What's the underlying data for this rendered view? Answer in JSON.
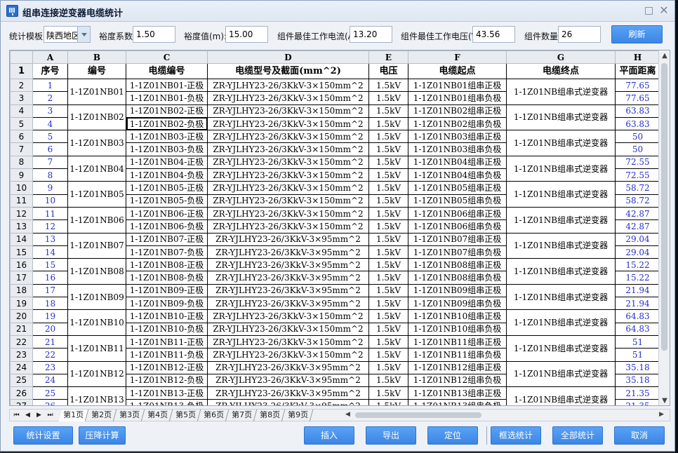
{
  "window": {
    "title": "组串连接逆变器电缆统计"
  },
  "toolbar": {
    "template_label": "统计模板:",
    "template_value": "陕西地区",
    "margin_coef_label": "裕度系数:",
    "margin_coef_value": "1.50",
    "margin_value_label": "裕度值(m):",
    "margin_value_value": "15.00",
    "best_current_label": "组件最佳工作电流(A):",
    "best_current_value": "13.20",
    "best_voltage_label": "组件最佳工作电压(V):",
    "best_voltage_value": "43.56",
    "module_count_label": "组件数量:",
    "module_count_value": "26",
    "refresh_label": "刷新"
  },
  "sheet": {
    "col_letters": [
      "A",
      "B",
      "C",
      "D",
      "E",
      "F",
      "G",
      "H"
    ],
    "header": [
      "序号",
      "编号",
      "电缆编号",
      "电缆型号及截面(mm^2)",
      "电压",
      "电缆起点",
      "电缆终点",
      "平面距离"
    ],
    "groups": [
      {
        "code": "1-1Z01NB01",
        "dest": "1-1Z01NB组串式逆变器",
        "rows": [
          {
            "seq": "1",
            "cable": "1-1Z01NB01-正极",
            "model": "ZR-YJLHY23-26/3KkV-3×150mm^2",
            "volt": "1.5kV",
            "start": "1-1Z01NB01组串正极",
            "dist": "77.65"
          },
          {
            "seq": "2",
            "cable": "1-1Z01NB01-负极",
            "model": "ZR-YJLHY23-26/3KkV-3×150mm^2",
            "volt": "1.5kV",
            "start": "1-1Z01NB01组串负极",
            "dist": "77.65"
          }
        ]
      },
      {
        "code": "1-1Z01NB02",
        "dest": "1-1Z01NB组串式逆变器",
        "rows": [
          {
            "seq": "3",
            "cable": "1-1Z01NB02-正极",
            "model": "ZR-YJLHY23-26/3KkV-3×150mm^2",
            "volt": "1.5kV",
            "start": "1-1Z01NB02组串正极",
            "dist": "63.83"
          },
          {
            "seq": "4",
            "cable": "1-1Z01NB02-负极",
            "model": "ZR-YJLHY23-26/3KkV-3×150mm^2",
            "volt": "1.5kV",
            "start": "1-1Z01NB02组串负极",
            "dist": "63.83"
          }
        ]
      },
      {
        "code": "1-1Z01NB03",
        "dest": "1-1Z01NB组串式逆变器",
        "rows": [
          {
            "seq": "5",
            "cable": "1-1Z01NB03-正极",
            "model": "ZR-YJLHY23-26/3KkV-3×150mm^2",
            "volt": "1.5kV",
            "start": "1-1Z01NB03组串正极",
            "dist": "50"
          },
          {
            "seq": "6",
            "cable": "1-1Z01NB03-负极",
            "model": "ZR-YJLHY23-26/3KkV-3×150mm^2",
            "volt": "1.5kV",
            "start": "1-1Z01NB03组串负极",
            "dist": "50"
          }
        ]
      },
      {
        "code": "1-1Z01NB04",
        "dest": "1-1Z01NB组串式逆变器",
        "rows": [
          {
            "seq": "7",
            "cable": "1-1Z01NB04-正极",
            "model": "ZR-YJLHY23-26/3KkV-3×150mm^2",
            "volt": "1.5kV",
            "start": "1-1Z01NB04组串正极",
            "dist": "72.55"
          },
          {
            "seq": "8",
            "cable": "1-1Z01NB04-负极",
            "model": "ZR-YJLHY23-26/3KkV-3×150mm^2",
            "volt": "1.5kV",
            "start": "1-1Z01NB04组串负极",
            "dist": "72.55"
          }
        ]
      },
      {
        "code": "1-1Z01NB05",
        "dest": "1-1Z01NB组串式逆变器",
        "rows": [
          {
            "seq": "9",
            "cable": "1-1Z01NB05-正极",
            "model": "ZR-YJLHY23-26/3KkV-3×150mm^2",
            "volt": "1.5kV",
            "start": "1-1Z01NB05组串正极",
            "dist": "58.72"
          },
          {
            "seq": "10",
            "cable": "1-1Z01NB05-负极",
            "model": "ZR-YJLHY23-26/3KkV-3×150mm^2",
            "volt": "1.5kV",
            "start": "1-1Z01NB05组串负极",
            "dist": "58.72"
          }
        ]
      },
      {
        "code": "1-1Z01NB06",
        "dest": "1-1Z01NB组串式逆变器",
        "rows": [
          {
            "seq": "11",
            "cable": "1-1Z01NB06-正极",
            "model": "ZR-YJLHY23-26/3KkV-3×150mm^2",
            "volt": "1.5kV",
            "start": "1-1Z01NB06组串正极",
            "dist": "42.87"
          },
          {
            "seq": "12",
            "cable": "1-1Z01NB06-负极",
            "model": "ZR-YJLHY23-26/3KkV-3×150mm^2",
            "volt": "1.5kV",
            "start": "1-1Z01NB06组串负极",
            "dist": "42.87"
          }
        ]
      },
      {
        "code": "1-1Z01NB07",
        "dest": "1-1Z01NB组串式逆变器",
        "rows": [
          {
            "seq": "13",
            "cable": "1-1Z01NB07-正极",
            "model": "ZR-YJLHY23-26/3KkV-3×95mm^2",
            "volt": "1.5kV",
            "start": "1-1Z01NB07组串正极",
            "dist": "29.04"
          },
          {
            "seq": "14",
            "cable": "1-1Z01NB07-负极",
            "model": "ZR-YJLHY23-26/3KkV-3×95mm^2",
            "volt": "1.5kV",
            "start": "1-1Z01NB07组串负极",
            "dist": "29.04"
          }
        ]
      },
      {
        "code": "1-1Z01NB08",
        "dest": "1-1Z01NB组串式逆变器",
        "rows": [
          {
            "seq": "15",
            "cable": "1-1Z01NB08-正极",
            "model": "ZR-YJLHY23-26/3KkV-3×95mm^2",
            "volt": "1.5kV",
            "start": "1-1Z01NB08组串正极",
            "dist": "15.22"
          },
          {
            "seq": "16",
            "cable": "1-1Z01NB08-负极",
            "model": "ZR-YJLHY23-26/3KkV-3×95mm^2",
            "volt": "1.5kV",
            "start": "1-1Z01NB08组串负极",
            "dist": "15.22"
          }
        ]
      },
      {
        "code": "1-1Z01NB09",
        "dest": "1-1Z01NB组串式逆变器",
        "rows": [
          {
            "seq": "17",
            "cable": "1-1Z01NB09-正极",
            "model": "ZR-YJLHY23-26/3KkV-3×95mm^2",
            "volt": "1.5kV",
            "start": "1-1Z01NB09组串正极",
            "dist": "21.94"
          },
          {
            "seq": "18",
            "cable": "1-1Z01NB09-负极",
            "model": "ZR-YJLHY23-26/3KkV-3×95mm^2",
            "volt": "1.5kV",
            "start": "1-1Z01NB09组串负极",
            "dist": "21.94"
          }
        ]
      },
      {
        "code": "1-1Z01NB10",
        "dest": "1-1Z01NB组串式逆变器",
        "rows": [
          {
            "seq": "19",
            "cable": "1-1Z01NB10-正极",
            "model": "ZR-YJLHY23-26/3KkV-3×150mm^2",
            "volt": "1.5kV",
            "start": "1-1Z01NB10组串正极",
            "dist": "64.83"
          },
          {
            "seq": "20",
            "cable": "1-1Z01NB10-负极",
            "model": "ZR-YJLHY23-26/3KkV-3×150mm^2",
            "volt": "1.5kV",
            "start": "1-1Z01NB10组串负极",
            "dist": "64.83"
          }
        ]
      },
      {
        "code": "1-1Z01NB11",
        "dest": "1-1Z01NB组串式逆变器",
        "rows": [
          {
            "seq": "21",
            "cable": "1-1Z01NB11-正极",
            "model": "ZR-YJLHY23-26/3KkV-3×150mm^2",
            "volt": "1.5kV",
            "start": "1-1Z01NB11组串正极",
            "dist": "51"
          },
          {
            "seq": "22",
            "cable": "1-1Z01NB11-负极",
            "model": "ZR-YJLHY23-26/3KkV-3×150mm^2",
            "volt": "1.5kV",
            "start": "1-1Z01NB11组串负极",
            "dist": "51"
          }
        ]
      },
      {
        "code": "1-1Z01NB12",
        "dest": "1-1Z01NB组串式逆变器",
        "rows": [
          {
            "seq": "23",
            "cable": "1-1Z01NB12-正极",
            "model": "ZR-YJLHY23-26/3KkV-3×95mm^2",
            "volt": "1.5kV",
            "start": "1-1Z01NB12组串正极",
            "dist": "35.18"
          },
          {
            "seq": "24",
            "cable": "1-1Z01NB12-负极",
            "model": "ZR-YJLHY23-26/3KkV-3×95mm^2",
            "volt": "1.5kV",
            "start": "1-1Z01NB12组串负极",
            "dist": "35.18"
          }
        ]
      },
      {
        "code": "1-1Z01NB13",
        "dest": "1-1Z01NB组串式逆变器",
        "rows": [
          {
            "seq": "25",
            "cable": "1-1Z01NB13-正极",
            "model": "ZR-YJLHY23-26/3KkV-3×95mm^2",
            "volt": "1.5kV",
            "start": "1-1Z01NB13组串正极",
            "dist": "21.35"
          },
          {
            "seq": "26",
            "cable": "1-1Z01NB13-负极",
            "model": "ZR-YJLHY23-26/3KkV-3×95mm^2",
            "volt": "1.5kV",
            "start": "1-1Z01NB13组串负极",
            "dist": "21.35"
          }
        ]
      }
    ]
  },
  "tabs": [
    "第1页",
    "第2页",
    "第3页",
    "第4页",
    "第5页",
    "第6页",
    "第7页",
    "第8页",
    "第9页"
  ],
  "bottom": {
    "settings_label": "统计设置",
    "fault_calc_label": "压降计算",
    "insert_label": "插入",
    "export_label": "导出",
    "locate_label": "定位",
    "box_stat_label": "框选统计",
    "all_stat_label": "全部统计",
    "cancel_label": "取消"
  }
}
